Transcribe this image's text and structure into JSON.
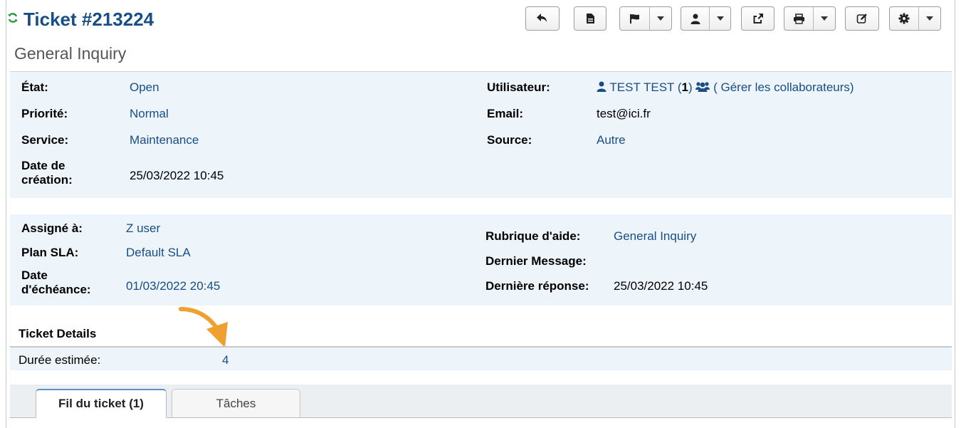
{
  "header": {
    "ticket_title": "Ticket #213224",
    "subject": "General Inquiry"
  },
  "toolbar": {
    "buttons": [
      {
        "icon": "reply-icon",
        "has_dropdown": false
      },
      {
        "icon": "document-icon",
        "has_dropdown": false
      },
      {
        "icon": "flag-icon",
        "has_dropdown": true
      },
      {
        "icon": "user-icon",
        "has_dropdown": true
      },
      {
        "icon": "share-icon",
        "has_dropdown": false
      },
      {
        "icon": "print-icon",
        "has_dropdown": true
      },
      {
        "icon": "edit-icon",
        "has_dropdown": false
      },
      {
        "icon": "gear-icon",
        "has_dropdown": true
      }
    ]
  },
  "info": {
    "state_label": "État:",
    "state_value": "Open",
    "priority_label": "Priorité:",
    "priority_value": "Normal",
    "service_label": "Service:",
    "service_value": "Maintenance",
    "created_label_1": "Date de",
    "created_label_2": "création:",
    "created_value": "25/03/2022 10:45",
    "user_label": "Utilisateur:",
    "user_name": "TEST TEST (",
    "user_count": "1",
    "user_close": ")",
    "collab_link": "( Gérer les collaborateurs)",
    "email_label": "Email:",
    "email_value": "test@ici.fr",
    "source_label": "Source:",
    "source_value": "Autre"
  },
  "assignment": {
    "assigned_label": "Assigné à:",
    "assigned_value": "Z user",
    "sla_label": "Plan SLA:",
    "sla_value": "Default SLA",
    "due_label_1": "Date",
    "due_label_2": "d'échéance:",
    "due_value": "01/03/2022 20:45",
    "topic_label": "Rubrique d'aide:",
    "topic_value": "General Inquiry",
    "last_message_label": "Dernier Message:",
    "last_reply_label": "Dernière réponse:",
    "last_reply_value": "25/03/2022 10:45"
  },
  "details": {
    "title": "Ticket Details",
    "duration_label": "Durée estimée:",
    "duration_value": "4"
  },
  "tabs": [
    {
      "label": "Fil du ticket (1)",
      "active": true
    },
    {
      "label": "Tâches",
      "active": false
    }
  ],
  "colors": {
    "link": "#184e86",
    "panel_bg": "#edf4fa",
    "refresh_icon": "#2a9a3a",
    "annotation_arrow": "#f0a030"
  }
}
